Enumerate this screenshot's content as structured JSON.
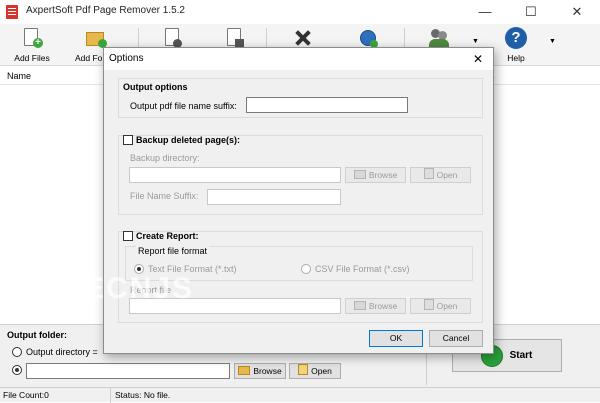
{
  "app": {
    "title": "AxpertSoft Pdf Page Remover 1.5.2"
  },
  "window_controls": {
    "minimize": "—",
    "maximize": "☐",
    "close": "✕"
  },
  "toolbar": {
    "add_files": "Add Files",
    "add_folder": "Add Fo",
    "help": "Help"
  },
  "list": {
    "col_name": "Name",
    "col_right_fragment": "s"
  },
  "bottom": {
    "output_folder_label": "Output folder:",
    "output_directory_option": "Output directory =",
    "browse": "Browse",
    "open": "Open",
    "start": "Start"
  },
  "status": {
    "file_count": "File Count:0",
    "status": "Status: No file."
  },
  "dialog": {
    "title": "Options",
    "close": "✕",
    "output_options": {
      "heading": "Output options",
      "suffix_label": "Output pdf file name suffix:",
      "suffix_value": ""
    },
    "backup": {
      "checkbox_label": "Backup deleted page(s):",
      "checked": false,
      "directory_label": "Backup directory:",
      "directory_value": "",
      "browse": "Browse",
      "open": "Open",
      "suffix_label": "File Name Suffix:",
      "suffix_value": ""
    },
    "report": {
      "checkbox_label": "Create Report:",
      "checked": false,
      "format_label": "Report file format",
      "format_txt": "Text File Format (*.txt)",
      "format_csv": "CSV File Format (*.csv)",
      "selected_format": "txt",
      "file_label": "Report file",
      "file_value": "",
      "browse": "Browse",
      "open": "Open"
    },
    "ok": "OK",
    "cancel": "Cancel"
  },
  "watermark": "ECNJS",
  "colors": {
    "start_icon": "#2aa13b",
    "help_icon": "#1f5fa8",
    "app_icon": "#d9342b"
  }
}
